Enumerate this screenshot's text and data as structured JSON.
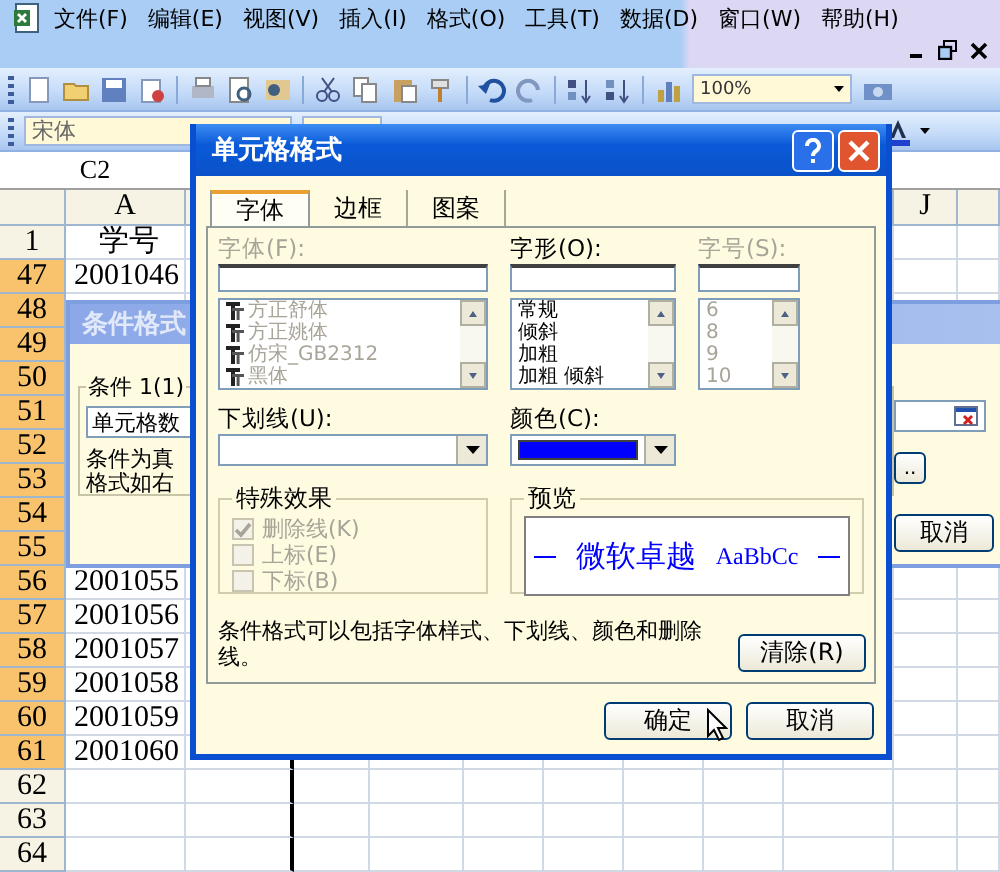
{
  "menu_bar": {
    "items": [
      "文件(F)",
      "编辑(E)",
      "视图(V)",
      "插入(I)",
      "格式(O)",
      "工具(T)",
      "数据(D)",
      "窗口(W)",
      "帮助(H)"
    ]
  },
  "standard_toolbar": {
    "zoom": "100%"
  },
  "formatting_toolbar": {
    "font": "宋体"
  },
  "name_box": "C2",
  "sheet": {
    "column_headers": [
      "A",
      "J"
    ],
    "rows": [
      {
        "header": "1",
        "selected": false,
        "cells": [
          "学号"
        ]
      },
      {
        "header": "47",
        "selected": true,
        "cells": [
          "2001046"
        ]
      },
      {
        "header": "48",
        "selected": true
      },
      {
        "header": "49",
        "selected": true
      },
      {
        "header": "50",
        "selected": true
      },
      {
        "header": "51",
        "selected": true
      },
      {
        "header": "52",
        "selected": true
      },
      {
        "header": "53",
        "selected": true
      },
      {
        "header": "54",
        "selected": true
      },
      {
        "header": "55",
        "selected": true
      },
      {
        "header": "56",
        "selected": true,
        "cells": [
          "2001055"
        ]
      },
      {
        "header": "57",
        "selected": true,
        "cells": [
          "2001056"
        ]
      },
      {
        "header": "58",
        "selected": true,
        "cells": [
          "2001057"
        ]
      },
      {
        "header": "59",
        "selected": true,
        "cells": [
          "2001058"
        ]
      },
      {
        "header": "60",
        "selected": true,
        "cells": [
          "2001059"
        ]
      },
      {
        "header": "61",
        "selected": true,
        "cells": [
          "2001060"
        ]
      },
      {
        "header": "62",
        "selected": false
      },
      {
        "header": "63",
        "selected": false
      },
      {
        "header": "64",
        "selected": false
      }
    ]
  },
  "conditional_format_dialog": {
    "title": "条件格式",
    "active": false,
    "condition": {
      "label": "条件 1(1)",
      "operator": "单元格数",
      "text_lines": [
        "条件为真",
        "格式如右"
      ]
    },
    "buttons": [
      "..",
      "取消"
    ]
  },
  "format_cells_dialog": {
    "title": "单元格格式",
    "active": true,
    "tabs": [
      {
        "label": "字体",
        "selected": true
      },
      {
        "label": "边框",
        "selected": false
      },
      {
        "label": "图案",
        "selected": false
      }
    ],
    "font": {
      "label": "字体(F):",
      "disabled": true,
      "items": [
        "方正舒体",
        "方正姚体",
        "仿宋_GB2312",
        "黑体"
      ]
    },
    "style": {
      "label": "字形(O):",
      "disabled": false,
      "items": [
        "常规",
        "倾斜",
        "加粗",
        "加粗  倾斜"
      ]
    },
    "size": {
      "label": "字号(S):",
      "disabled": true,
      "items": [
        "6",
        "8",
        "9",
        "10"
      ]
    },
    "underline": {
      "label": "下划线(U):"
    },
    "color": {
      "label": "颜色(C):",
      "color": "#0000ff"
    },
    "effects": {
      "title": "特殊效果",
      "options": [
        {
          "label": "删除线(K)",
          "checked": true,
          "disabled": true
        },
        {
          "label": "上标(E)",
          "checked": false,
          "disabled": true
        },
        {
          "label": "下标(B)",
          "checked": false,
          "disabled": true
        }
      ]
    },
    "preview": {
      "title": "预览",
      "text": "微软卓越",
      "sample": "AaBbCc"
    },
    "note": "条件格式可以包括字体样式、下划线、颜色和删除线。",
    "clear_button": "清除(R)",
    "buttons": [
      "确定",
      "取消"
    ]
  }
}
